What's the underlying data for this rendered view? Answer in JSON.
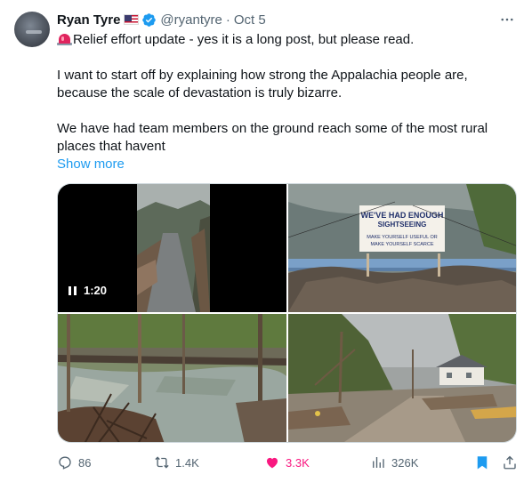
{
  "author": {
    "name": "Ryan Tyre",
    "handle": "@ryantyre",
    "separator": "·",
    "date": "Oct 5"
  },
  "post": {
    "lines": [
      "Relief effort update - yes it is a long post, but please read.",
      "I want to start off by explaining how strong the Appalachia people are,",
      "because the scale of devastation is truly bizarre.",
      "We have had team members on the ground reach some of the most rural",
      "places that havent"
    ],
    "show_more": "Show more"
  },
  "media": {
    "video_time": "1:20",
    "sign_lines": [
      "WE'VE HAD ENOUGH",
      "SIGHTSEEING",
      "MAKE YOURSELF USEFUL OR",
      "MAKE YOURSELF SCARCE"
    ]
  },
  "actions": {
    "replies": "86",
    "reposts": "1.4K",
    "likes": "3.3K",
    "views": "326K"
  },
  "colors": {
    "accent": "#1d9bf0",
    "like": "#f91880",
    "muted": "#536471",
    "text": "#0f1419"
  },
  "icons": [
    "verified-badge-icon",
    "us-flag-icon",
    "siren-icon",
    "more-icon",
    "pause-icon",
    "reply-icon",
    "repost-icon",
    "like-icon",
    "views-icon",
    "bookmark-icon",
    "share-icon"
  ]
}
